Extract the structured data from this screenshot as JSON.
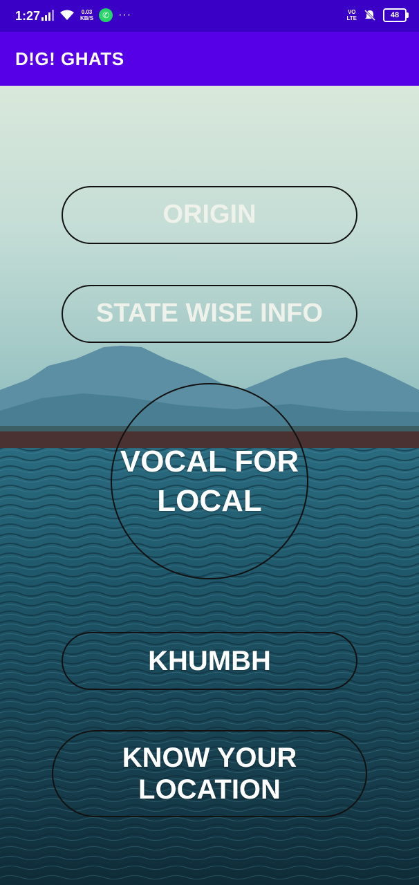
{
  "status_bar": {
    "time": "1:27",
    "net_speed_value": "0.03",
    "net_speed_unit": "KB/S",
    "volte_top": "VO",
    "volte_bottom": "LTE",
    "battery": "48"
  },
  "app_bar": {
    "title": "D!G! GHATS"
  },
  "buttons": {
    "origin": "ORIGIN",
    "state_wise_info": "STATE WISE INFO",
    "vocal_for_local_line1": "VOCAL FOR",
    "vocal_for_local_line2": "LOCAL",
    "khumbh": "KHUMBH",
    "know_your_location_line1": "KNOW YOUR",
    "know_your_location_line2": "LOCATION"
  },
  "colors": {
    "status_bar": "#3a00c6",
    "app_bar": "#5600e8",
    "sky": "#c4ddd6",
    "water": "#1d5466"
  }
}
